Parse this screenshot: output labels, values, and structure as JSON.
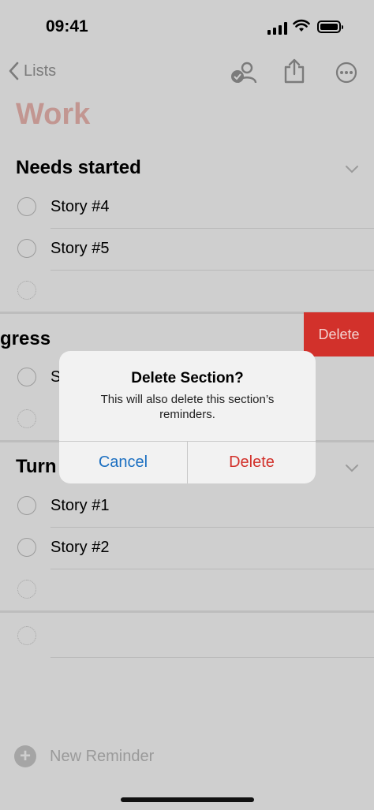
{
  "status": {
    "time": "09:41"
  },
  "nav": {
    "back_label": "Lists"
  },
  "list_title": "Work",
  "sections": [
    {
      "title": "Needs started",
      "items": [
        "Story #4",
        "Story #5"
      ]
    },
    {
      "title": "gress",
      "items": [
        "S"
      ]
    },
    {
      "title": "Turn",
      "items": [
        "Story #1",
        "Story #2"
      ]
    }
  ],
  "swipe_action": {
    "label": "Delete"
  },
  "alert": {
    "title": "Delete Section?",
    "message": "This will also delete this section’s reminders.",
    "cancel_label": "Cancel",
    "delete_label": "Delete"
  },
  "footer": {
    "new_reminder_label": "New Reminder"
  },
  "colors": {
    "accent_title": "#c29691",
    "destructive": "#d2312b",
    "link": "#1b6fc1"
  }
}
